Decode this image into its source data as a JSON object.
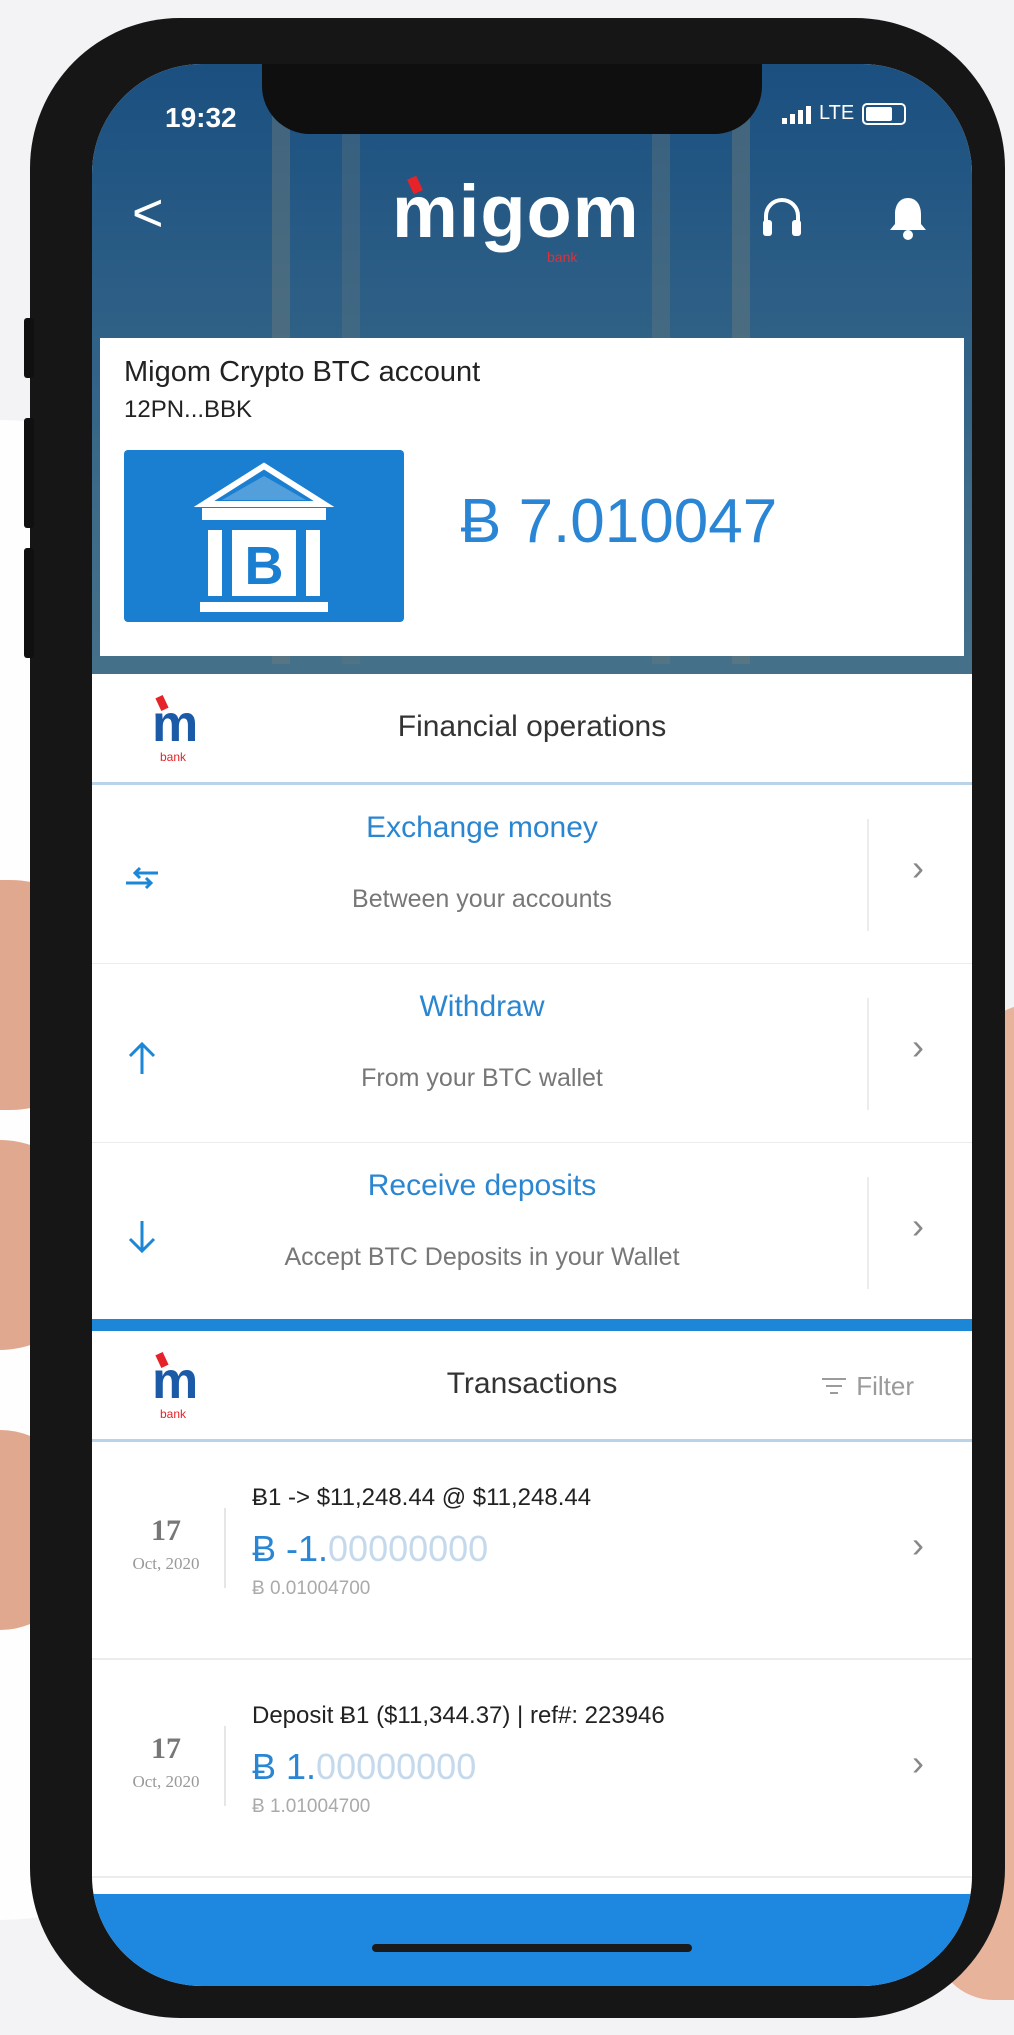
{
  "status_bar": {
    "time": "19:32",
    "network": "LTE"
  },
  "header": {
    "logo_text": "migom",
    "logo_sub": "bank",
    "icons": [
      "back-chevron-icon",
      "headset-icon",
      "bell-icon"
    ],
    "back_label": "<"
  },
  "account": {
    "name": "Migom Crypto BTC account",
    "id": "12PN...BBK",
    "balance": "Ƀ 7.010047",
    "tile_icon": "bank-bitcoin-icon"
  },
  "financial_ops": {
    "title": "Financial operations",
    "items": [
      {
        "title": "Exchange money",
        "subtitle": "Between your accounts",
        "icon": "exchange-arrows-icon"
      },
      {
        "title": "Withdraw",
        "subtitle": "From your BTC wallet",
        "icon": "arrow-up-icon"
      },
      {
        "title": "Receive deposits",
        "subtitle": "Accept BTC Deposits in your Wallet",
        "icon": "arrow-down-icon"
      }
    ]
  },
  "transactions": {
    "title": "Transactions",
    "filter_label": "Filter",
    "items": [
      {
        "day": "17",
        "month": "Oct, 2020",
        "description": "Ƀ1 -> $11,248.44 @ $11,248.44",
        "amount_main": "Ƀ -1.",
        "amount_decimals": "00000000",
        "balance": "Ƀ 0.01004700"
      },
      {
        "day": "17",
        "month": "Oct, 2020",
        "description": "Deposit Ƀ1 ($11,344.37) | ref#: 223946",
        "amount_main": "Ƀ 1.",
        "amount_decimals": "00000000",
        "balance": "Ƀ 1.01004700"
      }
    ]
  },
  "colors": {
    "accent": "#2a86d4",
    "footer": "#1e88e0",
    "logo_red": "#e52329",
    "tile_blue": "#1a7fd0"
  }
}
